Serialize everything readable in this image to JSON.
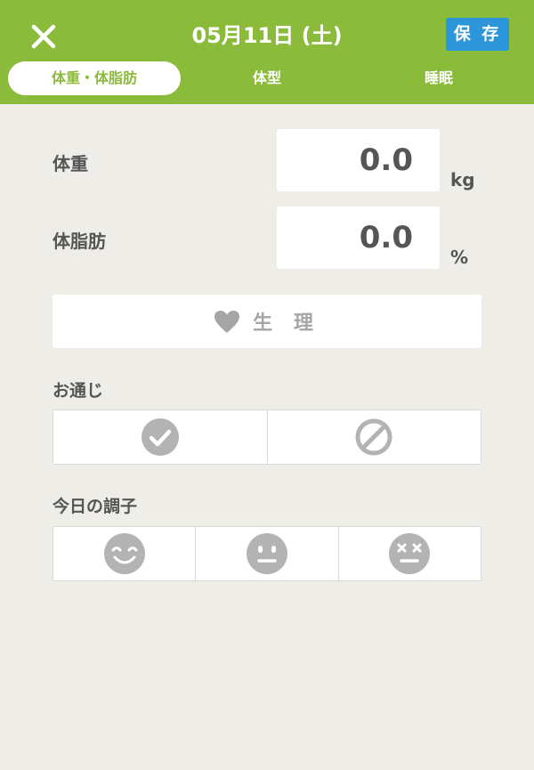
{
  "header": {
    "date": "05月11日 (土)",
    "save_label": "保 存"
  },
  "tabs": [
    {
      "label": "体重・体脂肪",
      "active": true
    },
    {
      "label": "体型",
      "active": false
    },
    {
      "label": "睡眠",
      "active": false
    }
  ],
  "weight": {
    "label": "体重",
    "value": "0.0",
    "unit": "kg"
  },
  "body_fat": {
    "label": "体脂肪",
    "value": "0.0",
    "unit": "%"
  },
  "period": {
    "label": "生 理",
    "icon": "heart-icon"
  },
  "bowel": {
    "title": "お通じ",
    "options": [
      {
        "icon": "check-circle-icon"
      },
      {
        "icon": "prohibited-icon"
      }
    ]
  },
  "condition": {
    "title": "今日の調子",
    "options": [
      {
        "icon": "smile-face-icon"
      },
      {
        "icon": "neutral-face-icon"
      },
      {
        "icon": "dizzy-face-icon"
      }
    ]
  },
  "colors": {
    "header_green": "#8BBB3A",
    "save_blue": "#2D96DA",
    "background": "#EEEDE8",
    "icon_gray": "#B3B3B3"
  }
}
